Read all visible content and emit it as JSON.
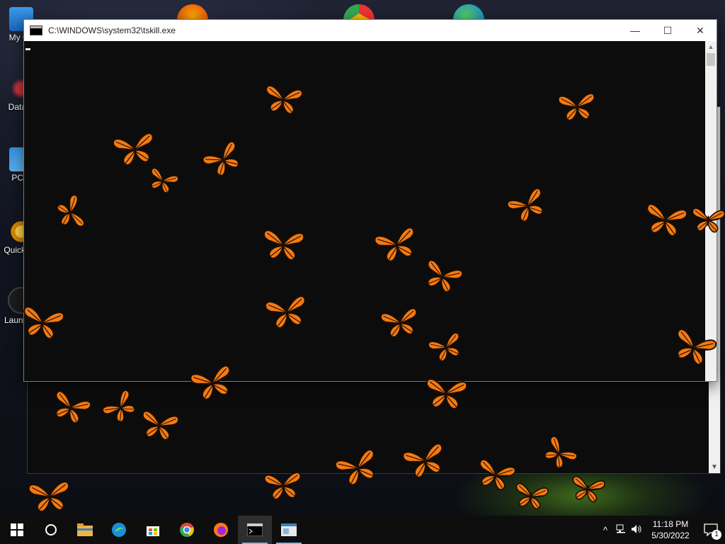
{
  "window": {
    "title": "C:\\WINDOWS\\system32\\tskill.exe",
    "minimize_symbol": "—",
    "maximize_symbol": "☐",
    "close_symbol": "✕"
  },
  "desktop_icons": [
    {
      "label": "My Co",
      "icon": "computer-icon"
    },
    {
      "label": "DataW",
      "icon": "datawarehouse-icon"
    },
    {
      "label": "PC F",
      "icon": "pc-icon"
    },
    {
      "label": "Quick Up",
      "icon": "gear-icon"
    },
    {
      "label": "Laun Cle",
      "icon": "cleaner-icon"
    }
  ],
  "taskbar": {
    "items": [
      {
        "name": "start-button",
        "icon": "windows-logo-icon"
      },
      {
        "name": "search-button",
        "icon": "search-circle-icon"
      },
      {
        "name": "file-explorer-button",
        "icon": "folder-icon"
      },
      {
        "name": "edge-button",
        "icon": "edge-icon"
      },
      {
        "name": "store-button",
        "icon": "store-icon"
      },
      {
        "name": "chrome-button",
        "icon": "chrome-icon"
      },
      {
        "name": "firefox-button",
        "icon": "firefox-icon"
      },
      {
        "name": "console-button",
        "icon": "console-icon"
      },
      {
        "name": "app-window-button",
        "icon": "window-icon"
      }
    ],
    "tray": {
      "chevron": "^",
      "network": "network-icon",
      "volume": "volume-icon",
      "time": "11:18 PM",
      "date": "5/30/2022",
      "notification_count": "1"
    }
  },
  "colors": {
    "butterfly_orange": "#f47a12",
    "butterfly_vein": "#1a0d05",
    "taskbar_bg": "#0e0e0e",
    "console_bg": "#0c0c0c",
    "accent": "#76b9ed"
  }
}
